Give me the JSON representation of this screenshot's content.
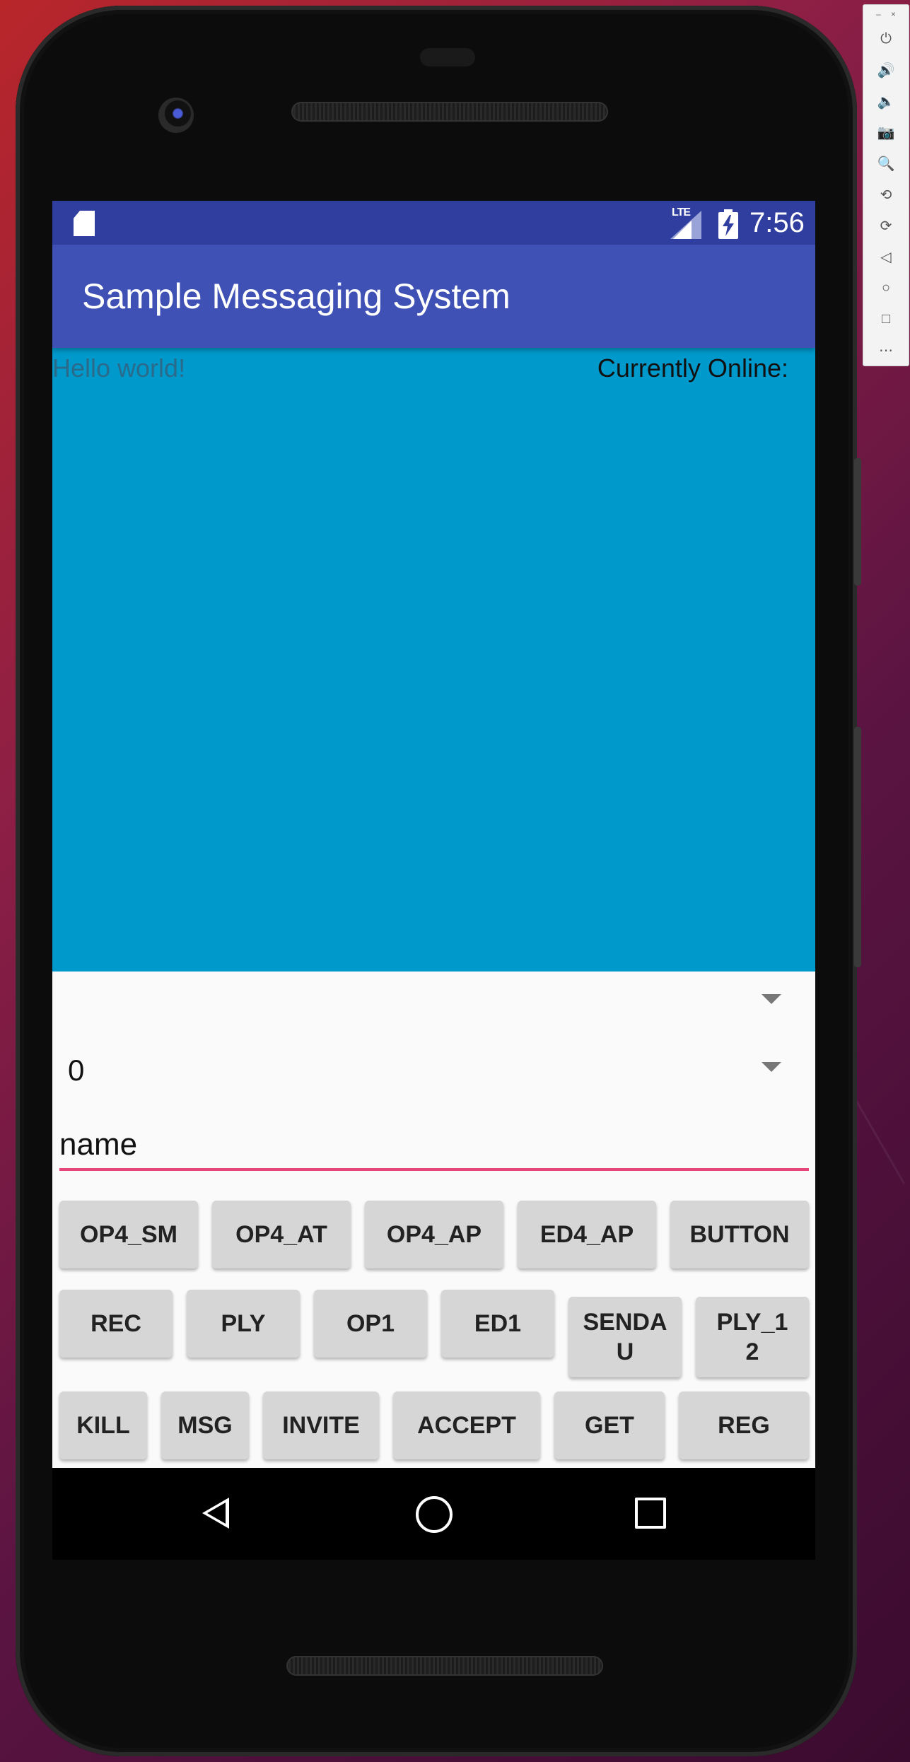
{
  "status_bar": {
    "network": "LTE",
    "time": "7:56"
  },
  "app_bar": {
    "title": "Sample Messaging System"
  },
  "content": {
    "hello_text": "Hello world!",
    "online_label": "Currently Online:"
  },
  "spinners": [
    {
      "value": ""
    },
    {
      "value": "0"
    }
  ],
  "name_field": {
    "value": "name"
  },
  "buttons": {
    "row1": [
      "OP4_SM",
      "OP4_AT",
      "OP4_AP",
      "ED4_AP",
      "BUTTON"
    ],
    "row2": [
      "REC",
      "PLY",
      "OP1",
      "ED1",
      "SENDA\nU",
      "PLY_1\n2"
    ],
    "row3": [
      "KILL",
      "MSG",
      "INVITE",
      "ACCEPT",
      "GET",
      "REG"
    ]
  },
  "emulator_toolbar": {
    "window_buttons": [
      "–",
      "×"
    ],
    "tools": [
      "power-icon",
      "volume-up-icon",
      "volume-down-icon",
      "camera-icon",
      "zoom-icon",
      "rotate-left-icon",
      "rotate-right-icon",
      "back-icon",
      "home-icon",
      "overview-icon",
      "more-icon"
    ]
  }
}
